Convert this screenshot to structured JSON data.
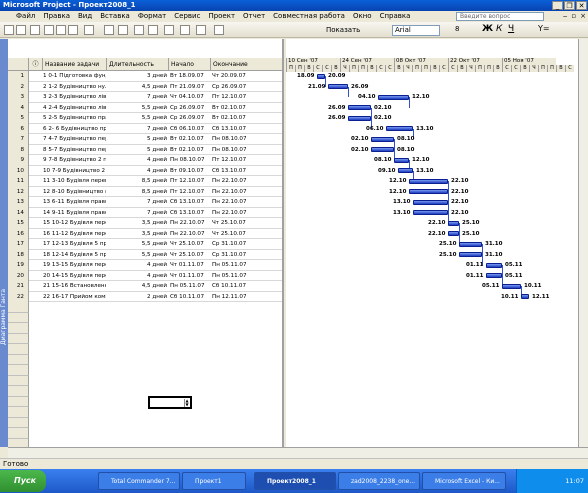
{
  "app": {
    "title": "Microsoft Project - Проект2008_1",
    "status": "Готово"
  },
  "menu": [
    "Файл",
    "Правка",
    "Вид",
    "Вставка",
    "Формат",
    "Сервис",
    "Проект",
    "Отчет",
    "Совместная работа",
    "Окно",
    "Справка"
  ],
  "help": {
    "placeholder": "Введите вопрос"
  },
  "toolbar": {
    "show_by": "Показать",
    "font": "Arial",
    "size": "8",
    "bold": "Ж",
    "italic": "К",
    "underline": "Ч",
    "filter": "Y="
  },
  "side_label": "Диаграмма Ганта",
  "columns": {
    "indicator": "ⓘ",
    "name": "Название задачи",
    "duration": "Длительность",
    "start": "Начало",
    "finish": "Окончание"
  },
  "tasks": [
    {
      "id": "1",
      "name": "1 0-1 Підготовка фундамен",
      "duration": "3 дней",
      "start": "Вт 18.09.07",
      "finish": "Чт 20.09.07"
    },
    {
      "id": "2",
      "name": "2 1-2 Будівництво нульо",
      "duration": "4,5 дней",
      "start": "Пт 21.09.07",
      "finish": "Ср 26.09.07"
    },
    {
      "id": "3",
      "name": "3 2-3 Будівництво лівої з",
      "duration": "7 дней",
      "start": "Чт 04.10.07",
      "finish": "Пт 12.10.07"
    },
    {
      "id": "4",
      "name": "4 2-4 Будівництво лівої в",
      "duration": "5,5 дней",
      "start": "Ср 26.09.07",
      "finish": "Вт 02.10.07"
    },
    {
      "id": "5",
      "name": "5 2-5 Будівництво право",
      "duration": "5,5 дней",
      "start": "Ср 26.09.07",
      "finish": "Вт 02.10.07"
    },
    {
      "id": "6",
      "name": "6 2- 6 Будівництво право",
      "duration": "7 дней",
      "start": "Сб 06.10.07",
      "finish": "Сб 13.10.07"
    },
    {
      "id": "7",
      "name": "7 4-7 Будівництво перекр",
      "duration": "5 дней",
      "start": "Вт 02.10.07",
      "finish": "Пн 08.10.07"
    },
    {
      "id": "8",
      "name": "8 5-7 Будівництво перекр",
      "duration": "5 дней",
      "start": "Вт 02.10.07",
      "finish": "Пн 08.10.07"
    },
    {
      "id": "9",
      "name": "9 7-8 Будівництво 2 пове",
      "duration": "4 дней",
      "start": "Пн 08.10.07",
      "finish": "Пт 12.10.07"
    },
    {
      "id": "10",
      "name": "10 7-9 Будівництво 2 пов",
      "duration": "4 дней",
      "start": "Вт 09.10.07",
      "finish": "Сб 13.10.07"
    },
    {
      "id": "11",
      "name": "11 3-10 Будівля перекрит",
      "duration": "8,5 дней",
      "start": "Пт 12.10.07",
      "finish": "Пн 22.10.07"
    },
    {
      "id": "12",
      "name": "12 8-10 Будівництво пер",
      "duration": "8,5 дней",
      "start": "Пт 12.10.07",
      "finish": "Пн 22.10.07"
    },
    {
      "id": "13",
      "name": "13 6-11 Будівля правого",
      "duration": "7 дней",
      "start": "Сб 13.10.07",
      "finish": "Пн 22.10.07"
    },
    {
      "id": "14",
      "name": "14 9-11 Будівля правого",
      "duration": "7 дней",
      "start": "Сб 13.10.07",
      "finish": "Пн 22.10.07"
    },
    {
      "id": "15",
      "name": "15 10-12 Будівля перекрит",
      "duration": "3,5 дней",
      "start": "Пн 22.10.07",
      "finish": "Чт 25.10.07"
    },
    {
      "id": "16",
      "name": "16 11-12 Будівля перекрит",
      "duration": "3,5 дней",
      "start": "Пн 22.10.07",
      "finish": "Чт 25.10.07"
    },
    {
      "id": "17",
      "name": "17 12-13 Будівля 5 прост",
      "duration": "5,5 дней",
      "start": "Чт 25.10.07",
      "finish": "Ср 31.10.07"
    },
    {
      "id": "18",
      "name": "18 12-14 Будівля 5 прост",
      "duration": "5,5 дней",
      "start": "Чт 25.10.07",
      "finish": "Ср 31.10.07"
    },
    {
      "id": "19",
      "name": "19 13-15 Будівля перекрит",
      "duration": "4 дней",
      "start": "Чт 01.11.07",
      "finish": "Пн 05.11.07"
    },
    {
      "id": "20",
      "name": "20 14-15 Будівля перекрит",
      "duration": "4 дней",
      "start": "Чт 01.11.07",
      "finish": "Пн 05.11.07"
    },
    {
      "id": "21",
      "name": "21 15-16 Встановлення д",
      "duration": "4,5 дней",
      "start": "Пн 05.11.07",
      "finish": "Сб 10.11.07"
    },
    {
      "id": "22",
      "name": "22 16-17 Прийом комісії б",
      "duration": "2 дней",
      "start": "Сб 10.11.07",
      "finish": "Пн 12.11.07"
    }
  ],
  "gantt": {
    "weeks": [
      "10 Сен '07",
      "24 Сен '07",
      "08 Окт '07",
      "22 Окт '07",
      "05 Ноя '07"
    ],
    "days": [
      "П",
      "П",
      "В",
      "С",
      "С",
      "В",
      "Ч",
      "П",
      "П",
      "В",
      "С",
      "С",
      "В",
      "Ч",
      "П",
      "П",
      "В",
      "С",
      "С",
      "В",
      "Ч",
      "П",
      "П",
      "В",
      "С",
      "С",
      "В",
      "Ч",
      "П",
      "П",
      "В",
      "С"
    ],
    "bars": [
      {
        "row": 1,
        "start": "18.09",
        "end": "20.09",
        "ls": "18.09",
        "le": "20.09"
      },
      {
        "row": 2,
        "start": "21.09",
        "end": "26.09",
        "ls": "21.09",
        "le": "26.09"
      },
      {
        "row": 3,
        "start": "04.10",
        "end": "12.10",
        "ls": "04.10",
        "le": "12.10"
      },
      {
        "row": 4,
        "start": "26.09",
        "end": "02.10",
        "ls": "26.09",
        "le": "02.10"
      },
      {
        "row": 5,
        "start": "26.09",
        "end": "02.10",
        "ls": "26.09",
        "le": "02.10"
      },
      {
        "row": 6,
        "start": "06.10",
        "end": "13.10",
        "ls": "06.10",
        "le": "13.10"
      },
      {
        "row": 7,
        "start": "02.10",
        "end": "08.10",
        "ls": "02.10",
        "le": "08.10"
      },
      {
        "row": 8,
        "start": "02.10",
        "end": "08.10",
        "ls": "02.10",
        "le": "08.10"
      },
      {
        "row": 9,
        "start": "08.10",
        "end": "12.10",
        "ls": "08.10",
        "le": "12.10"
      },
      {
        "row": 10,
        "start": "09.10",
        "end": "13.10",
        "ls": "09.10",
        "le": "13.10"
      },
      {
        "row": 11,
        "start": "12.10",
        "end": "22.10",
        "ls": "12.10",
        "le": "22.10"
      },
      {
        "row": 12,
        "start": "12.10",
        "end": "22.10",
        "ls": "12.10",
        "le": "22.10"
      },
      {
        "row": 13,
        "start": "13.10",
        "end": "22.10",
        "ls": "13.10",
        "le": "22.10"
      },
      {
        "row": 14,
        "start": "13.10",
        "end": "22.10",
        "ls": "13.10",
        "le": "22.10"
      },
      {
        "row": 15,
        "start": "22.10",
        "end": "25.10",
        "ls": "22.10",
        "le": "25.10"
      },
      {
        "row": 16,
        "start": "22.10",
        "end": "25.10",
        "ls": "22.10",
        "le": "25.10"
      },
      {
        "row": 17,
        "start": "25.10",
        "end": "31.10",
        "ls": "25.10",
        "le": "31.10"
      },
      {
        "row": 18,
        "start": "25.10",
        "end": "31.10",
        "ls": "25.10",
        "le": "31.10"
      },
      {
        "row": 19,
        "start": "01.11",
        "end": "05.11",
        "ls": "01.11",
        "le": "05.11"
      },
      {
        "row": 20,
        "start": "01.11",
        "end": "05.11",
        "ls": "01.11",
        "le": "05.11"
      },
      {
        "row": 21,
        "start": "05.11",
        "end": "10.11",
        "ls": "05.11",
        "le": "10.11"
      },
      {
        "row": 22,
        "start": "10.11",
        "end": "12.11",
        "ls": "10.11",
        "le": "12.11"
      }
    ]
  },
  "taskbar": {
    "start": "Пуск",
    "tasks": [
      "Total Commander 7...",
      "Проект1",
      "Проект2008_1",
      "zad2008_2238_one...",
      "Microsoft Excel - Ки..."
    ],
    "clock": "11:07"
  }
}
